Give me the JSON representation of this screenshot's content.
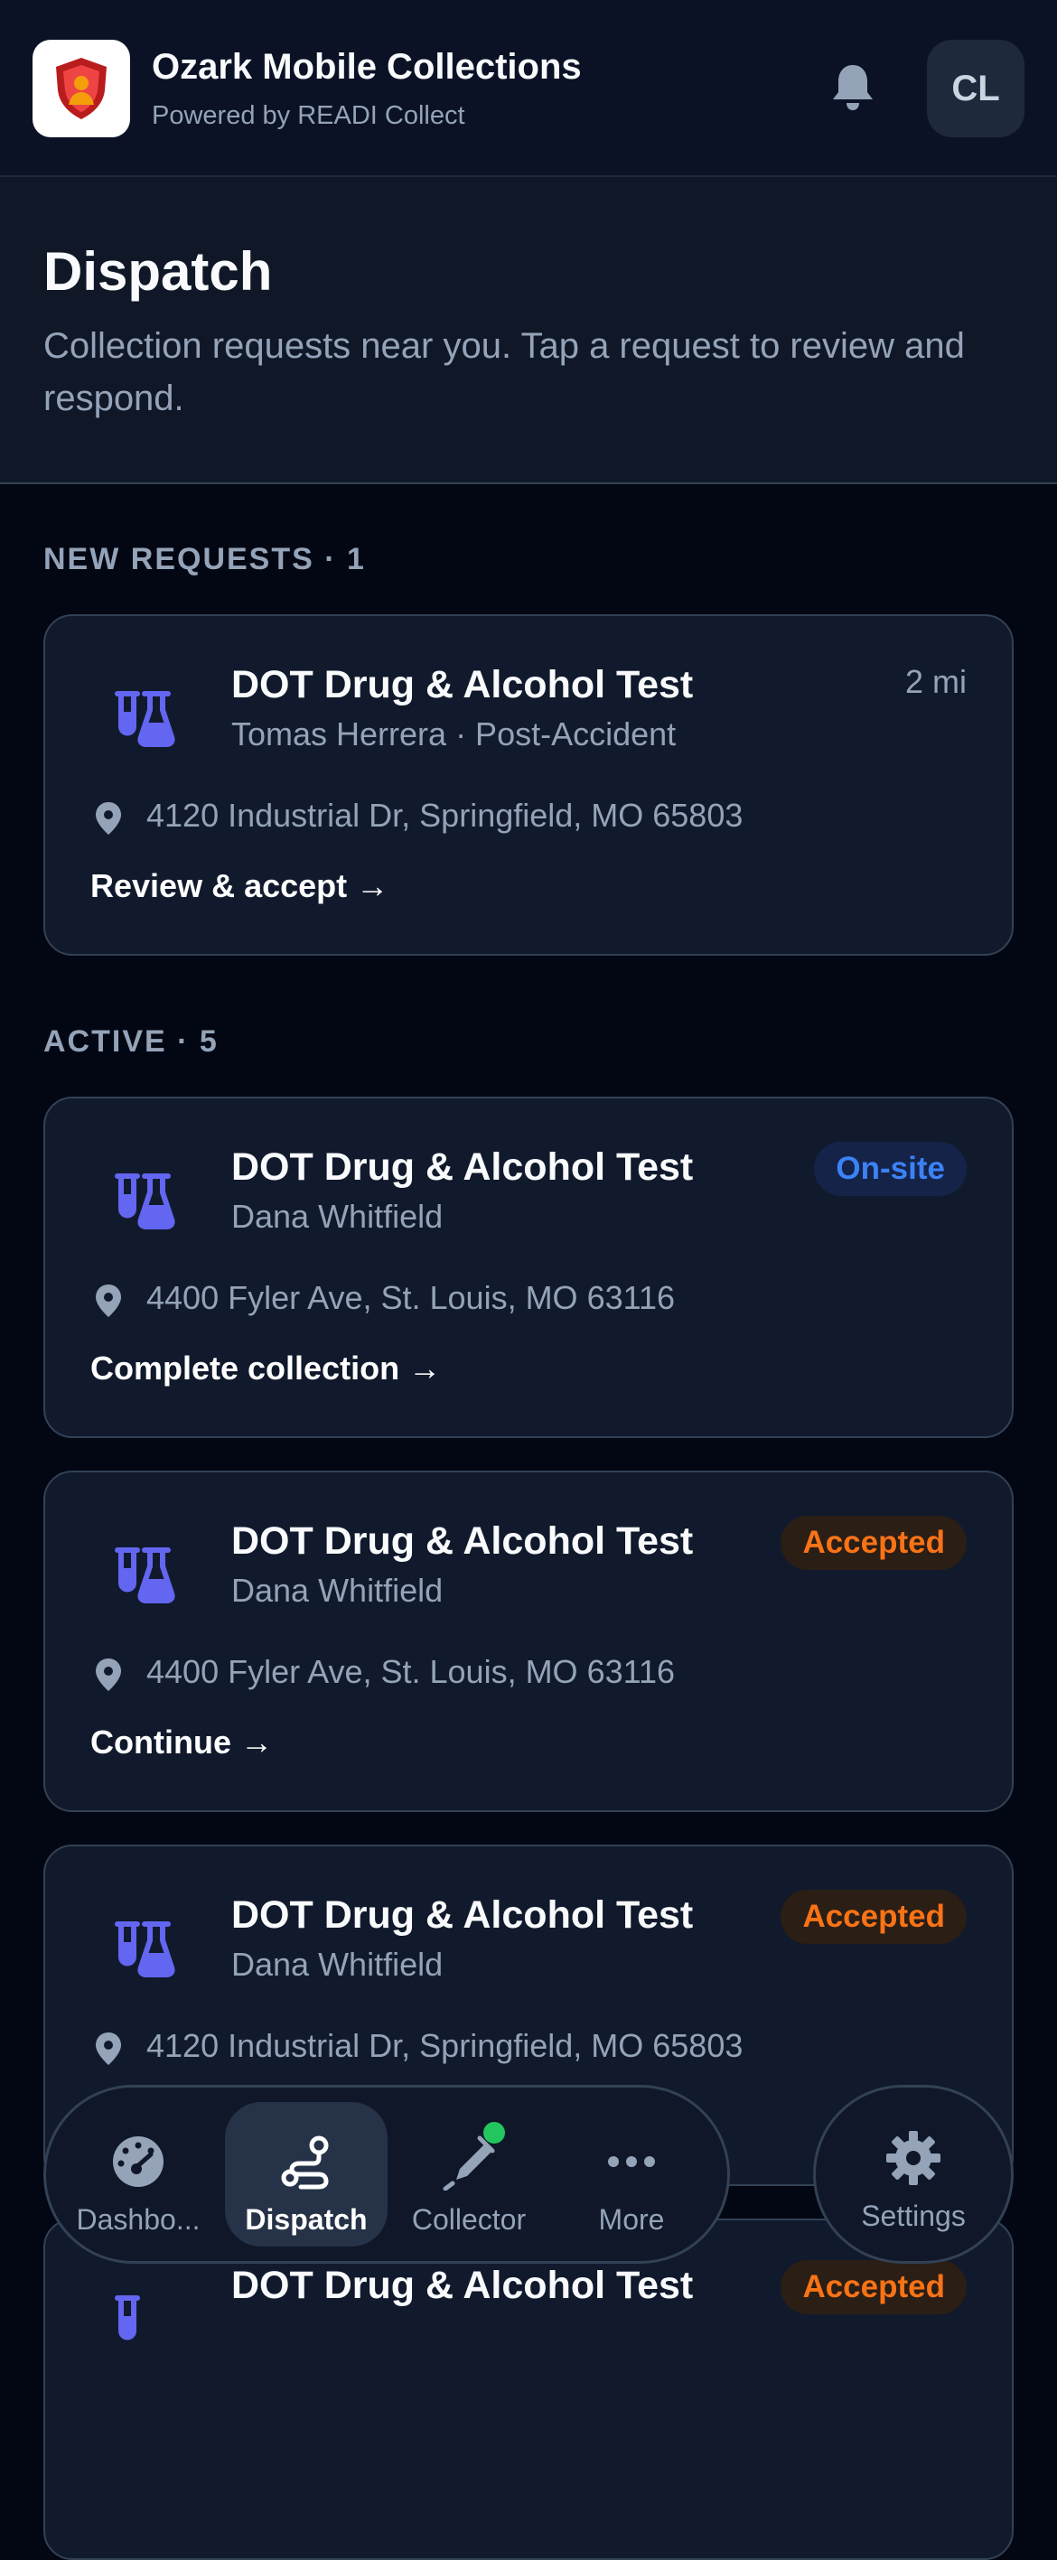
{
  "app": {
    "title": "Ozark Mobile Collections",
    "subtitle": "Powered by READI Collect",
    "avatar_initials": "CL"
  },
  "page": {
    "title": "Dispatch",
    "description": "Collection requests near you. Tap a request to review and respond."
  },
  "sections": {
    "new_label": "NEW REQUESTS · 1",
    "active_label": "ACTIVE · 5"
  },
  "new_requests": [
    {
      "title": "DOT Drug & Alcohol Test",
      "subtitle": "Tomas Herrera · Post-Accident",
      "distance": "2 mi",
      "address": "4120 Industrial Dr, Springfield, MO 65803",
      "action": "Review & accept →"
    }
  ],
  "active": [
    {
      "title": "DOT Drug & Alcohol Test",
      "subtitle": "Dana Whitfield",
      "status": "On-site",
      "address": "4400 Fyler Ave, St. Louis, MO 63116",
      "action": "Complete collection →"
    },
    {
      "title": "DOT Drug & Alcohol Test",
      "subtitle": "Dana Whitfield",
      "status": "Accepted",
      "address": "4400 Fyler Ave, St. Louis, MO 63116",
      "action": "Continue →"
    },
    {
      "title": "DOT Drug & Alcohol Test",
      "subtitle": "Dana Whitfield",
      "status": "Accepted",
      "address": "4120 Industrial Dr, Springfield, MO 65803",
      "action": ""
    },
    {
      "title": "DOT Drug & Alcohol Test",
      "subtitle": "",
      "status": "Accepted",
      "address": "",
      "action": ""
    }
  ],
  "nav": {
    "items": [
      {
        "label": "Dashbo...",
        "icon": "gauge-icon"
      },
      {
        "label": "Dispatch",
        "icon": "route-icon"
      },
      {
        "label": "Collector",
        "icon": "syringe-icon"
      },
      {
        "label": "More",
        "icon": "more-icon"
      }
    ],
    "settings_label": "Settings",
    "active_index": 1
  },
  "colors": {
    "accent": "#6366f1",
    "onsite": "#3b82f6",
    "accepted": "#f97316",
    "online_dot": "#22c55e"
  }
}
